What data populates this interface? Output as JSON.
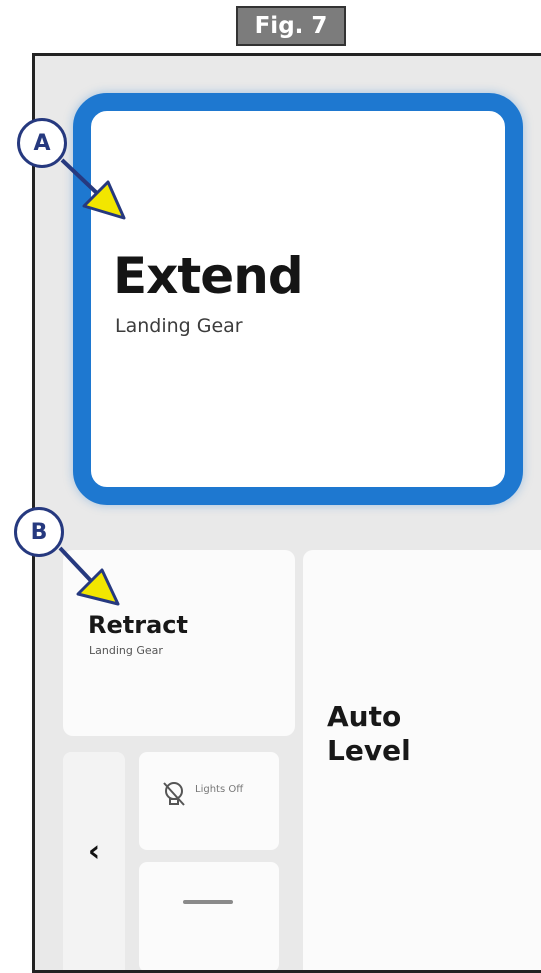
{
  "figure": {
    "label": "Fig. 7"
  },
  "callouts": {
    "a": "A",
    "b": "B"
  },
  "tiles": {
    "extend": {
      "title": "Extend",
      "subtitle": "Landing Gear"
    },
    "retract": {
      "title": "Retract",
      "subtitle": "Landing Gear"
    },
    "auto_level": {
      "line1": "Auto",
      "line2": "Level"
    },
    "lights": {
      "label": "Lights Off",
      "icon": "lightbulb-off-icon"
    },
    "back": {
      "icon": "chevron-left-icon",
      "glyph": "‹"
    },
    "minus": {
      "icon": "minus-icon"
    }
  },
  "colors": {
    "highlight": "#1e78d0",
    "callout_border": "#26397f",
    "arrow_fill": "#f2e600"
  }
}
